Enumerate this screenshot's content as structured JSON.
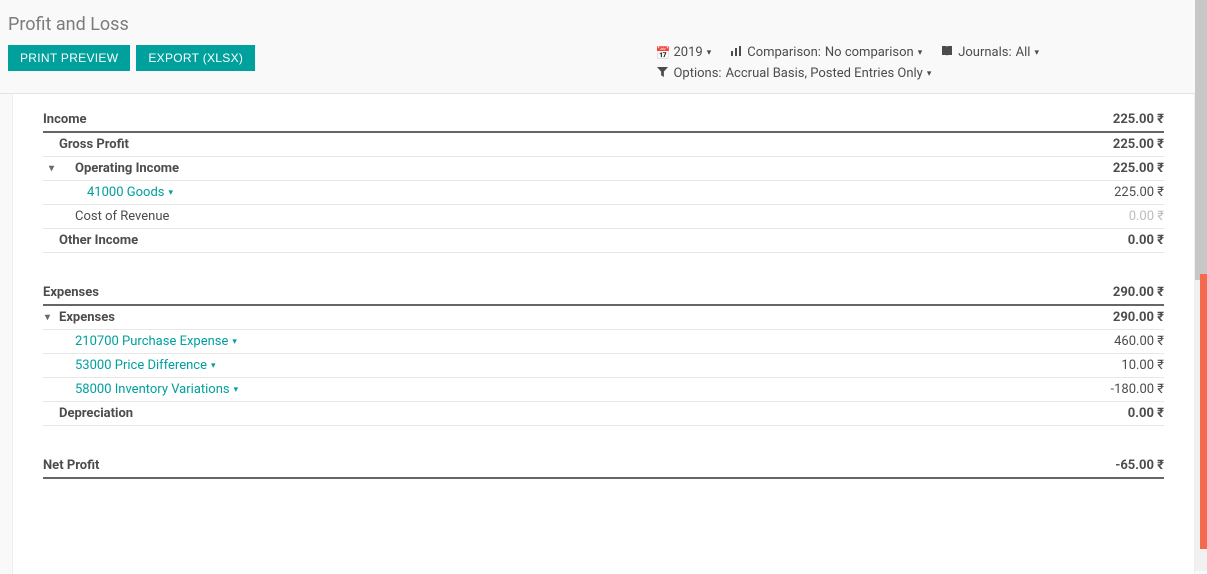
{
  "page": {
    "title": "Profit and Loss"
  },
  "toolbar": {
    "print_label": "PRINT PREVIEW",
    "export_label": "EXPORT (XLSX)"
  },
  "filters": {
    "period_value": "2019",
    "comparison_label": "Comparison:",
    "comparison_value": "No comparison",
    "journals_label": "Journals:",
    "journals_value": "All",
    "options_label": "Options:",
    "options_value": "Accrual Basis, Posted Entries Only"
  },
  "currency": "₹",
  "income": {
    "title": "Income",
    "total": "225.00 ₹",
    "gross_profit": {
      "label": "Gross Profit",
      "value": "225.00 ₹"
    },
    "operating_income": {
      "label": "Operating Income",
      "value": "225.00 ₹",
      "accounts": [
        {
          "name": "41000 Goods",
          "value": "225.00 ₹"
        }
      ]
    },
    "cost_of_revenue": {
      "label": "Cost of Revenue",
      "value": "0.00 ₹"
    },
    "other_income": {
      "label": "Other Income",
      "value": "0.00 ₹"
    }
  },
  "expenses": {
    "title": "Expenses",
    "total": "290.00 ₹",
    "expenses_sub": {
      "label": "Expenses",
      "value": "290.00 ₹",
      "accounts": [
        {
          "name": "210700 Purchase Expense",
          "value": "460.00 ₹"
        },
        {
          "name": "53000 Price Difference",
          "value": "10.00 ₹"
        },
        {
          "name": "58000 Inventory Variations",
          "value": "-180.00 ₹"
        }
      ]
    },
    "depreciation": {
      "label": "Depreciation",
      "value": "0.00 ₹"
    }
  },
  "net_profit": {
    "label": "Net Profit",
    "value": "-65.00 ₹"
  }
}
